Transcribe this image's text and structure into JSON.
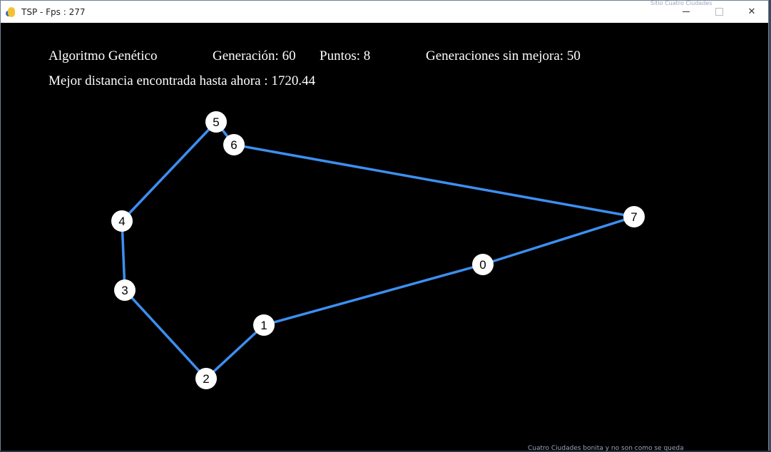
{
  "window": {
    "title": "TSP - Fps : 277",
    "icon": "python-snake-icon",
    "controls": [
      "minimize-icon",
      "maximize-icon",
      "close-icon"
    ],
    "close_glyph": "✕"
  },
  "hud": {
    "algorithm": "Algoritmo Genético",
    "generation": "Generación: 60",
    "points": "Puntos: 8",
    "gens_without_improvement": "Generaciones sin mejora: 50",
    "best_distance": "Mejor distancia encontrada hasta ahora : 1720.44"
  },
  "graph": {
    "edge_color": "#3d8ff0",
    "node_fill": "#ffffff",
    "nodes": [
      {
        "label": "0"
      },
      {
        "label": "1"
      },
      {
        "label": "2"
      },
      {
        "label": "3"
      },
      {
        "label": "4"
      },
      {
        "label": "5"
      },
      {
        "label": "6"
      },
      {
        "label": "7"
      }
    ],
    "tour": [
      "0",
      "1",
      "2",
      "3",
      "4",
      "5",
      "6",
      "7",
      "0"
    ]
  },
  "background": {
    "bottom_text": "Cuatro Ciudades bonita  y  no son como se queda",
    "top_text": "Sitio Cuatro Ciudades"
  }
}
